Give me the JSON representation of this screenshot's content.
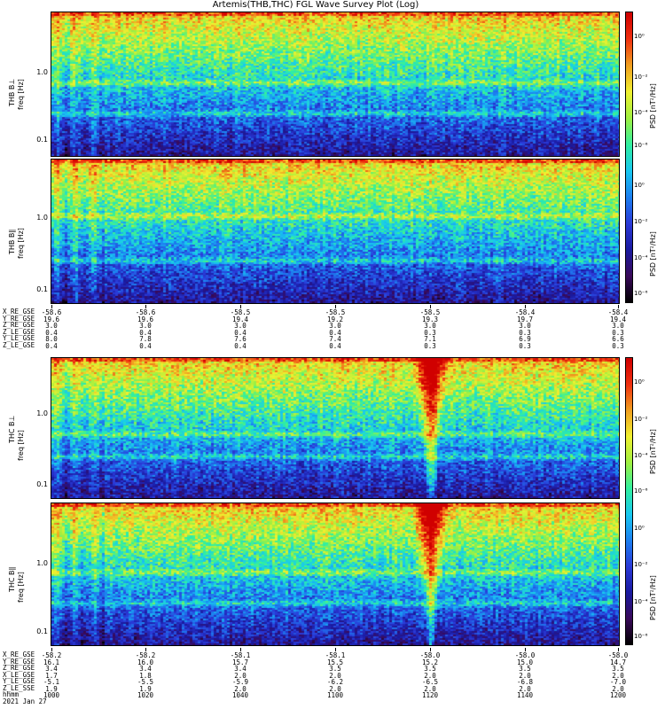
{
  "title": "Artemis(THB,THC) FGL Wave Survey Plot (Log)",
  "colorbar_label": "PSD [nT²/Hz]",
  "colormap": [
    "#000000",
    "#3a0a5a",
    "#1a1aa0",
    "#2a3ad8",
    "#1c7ff0",
    "#18c8f0",
    "#30f0a0",
    "#a0f040",
    "#f0f030",
    "#f0a020",
    "#f03010",
    "#d00000"
  ],
  "colorbar_ticks": [
    "10⁰",
    "10⁻²",
    "10⁻⁴",
    "10⁻⁶"
  ],
  "chart_data": [
    {
      "type": "heatmap",
      "probe": "THB",
      "component": "B⊥",
      "ylabel_line1": "THB B⊥",
      "ylabel_line2": "freq [Hz]",
      "yscale": "log",
      "ytick_labels": [
        "1.0",
        "0.1"
      ],
      "persistent_lines_hz": [
        0.64,
        0.24
      ],
      "burst_time": null
    },
    {
      "type": "heatmap",
      "probe": "THB",
      "component": "B∥",
      "ylabel_line1": "THB B∥",
      "ylabel_line2": "freq [Hz]",
      "yscale": "log",
      "ytick_labels": [
        "1.0",
        "0.1"
      ],
      "persistent_lines_hz": [
        1.0,
        0.24
      ],
      "burst_time": null
    },
    {
      "type": "heatmap",
      "probe": "THC",
      "component": "B⊥",
      "ylabel_line1": "THC B⊥",
      "ylabel_line2": "freq [Hz]",
      "yscale": "log",
      "ytick_labels": [
        "1.0",
        "0.1"
      ],
      "persistent_lines_hz": [
        0.5,
        0.24
      ],
      "burst_time": "1120"
    },
    {
      "type": "heatmap",
      "probe": "THC",
      "component": "B∥",
      "ylabel_line1": "THC B∥",
      "ylabel_line2": "freq [Hz]",
      "yscale": "log",
      "ytick_labels": [
        "1.0",
        "0.1"
      ],
      "persistent_lines_hz": [
        0.65,
        0.24
      ],
      "burst_time": "1120"
    }
  ],
  "thb_annotation": {
    "row_labels": [
      "X_RE_GSE",
      "Y_RE_GSE",
      "Z_RE_GSE",
      "Z_LE_GSE",
      "Y_LE_GSE",
      "Z_LE_GSE"
    ],
    "columns": [
      [
        "-58.6",
        "19.6",
        "3.0",
        "0.4",
        "8.0",
        "0.4"
      ],
      [
        "-58.6",
        "19.6",
        "3.0",
        "0.4",
        "7.8",
        "0.4"
      ],
      [
        "-58.5",
        "19.4",
        "3.0",
        "0.4",
        "7.6",
        "0.4"
      ],
      [
        "-58.5",
        "19.2",
        "3.0",
        "0.4",
        "7.4",
        "0.4"
      ],
      [
        "-58.5",
        "19.3",
        "3.0",
        "0.3",
        "7.1",
        "0.3"
      ],
      [
        "-58.4",
        "19.7",
        "3.0",
        "0.3",
        "6.9",
        "0.3"
      ],
      [
        "-58.4",
        "19.4",
        "3.0",
        "0.3",
        "6.6",
        "0.3"
      ]
    ]
  },
  "thc_annotation": {
    "row_labels": [
      "X_RE_GSE",
      "Y_RE_GSE",
      "Z_RE_GSE",
      "X_LE_GSE",
      "Y_LE_GSE",
      "Z_LE_SSE",
      "hhmm",
      "2021 Jan 27"
    ],
    "columns": [
      [
        "-58.2",
        "16.1",
        "3.4",
        "1.7",
        "-5.1",
        "1.9",
        "1000"
      ],
      [
        "-58.2",
        "16.0",
        "3.4",
        "1.8",
        "-5.5",
        "1.9",
        "1020"
      ],
      [
        "-58.1",
        "15.7",
        "3.4",
        "2.0",
        "-5.9",
        "2.0",
        "1040"
      ],
      [
        "-58.1",
        "15.5",
        "3.5",
        "2.0",
        "-6.2",
        "2.0",
        "1100"
      ],
      [
        "-58.0",
        "15.2",
        "3.5",
        "2.0",
        "-6.5",
        "2.0",
        "1120"
      ],
      [
        "-58.0",
        "15.0",
        "3.5",
        "2.0",
        "-6.8",
        "2.0",
        "1140"
      ],
      [
        "-58.0",
        "14.7",
        "3.5",
        "2.0",
        "-7.0",
        "2.0",
        "1200"
      ]
    ]
  }
}
